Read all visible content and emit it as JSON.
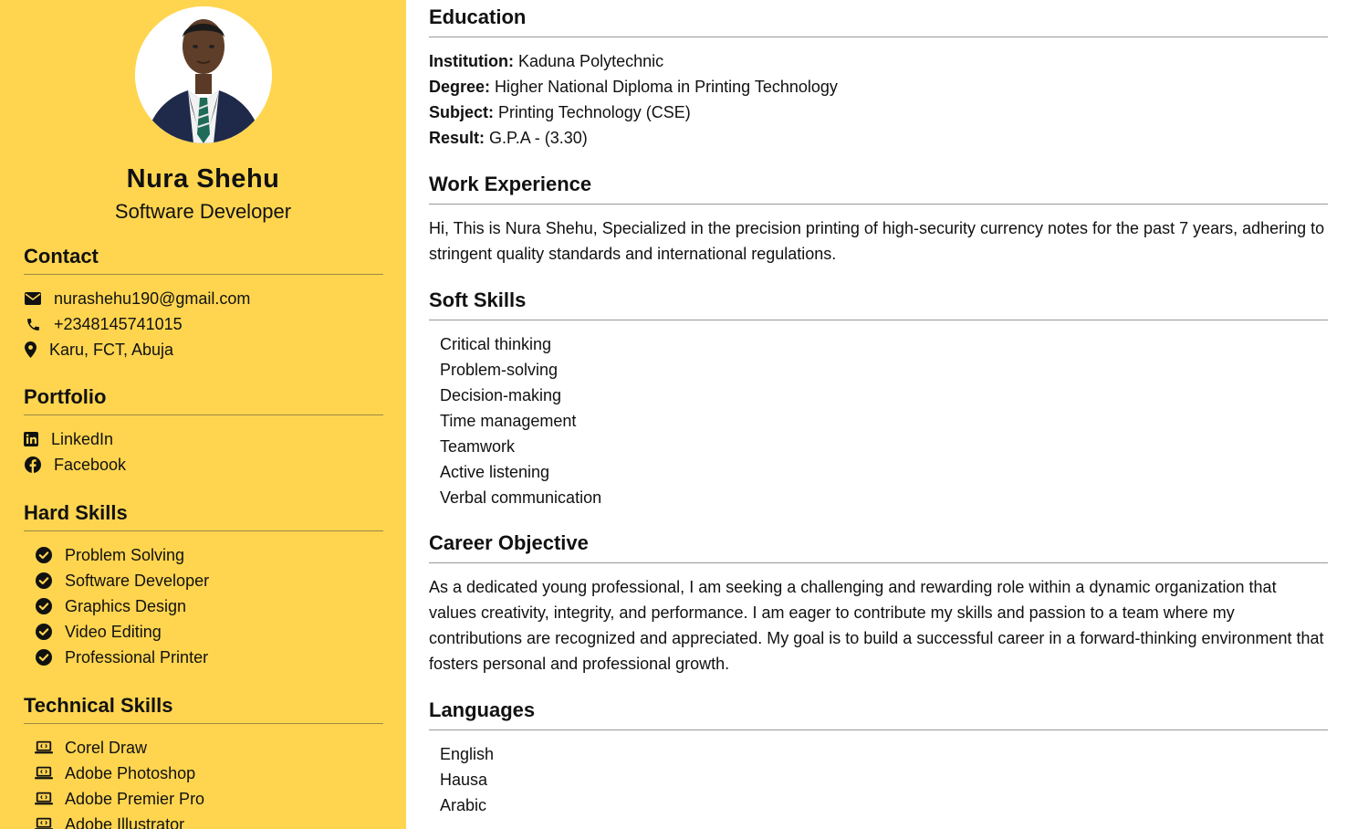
{
  "profile": {
    "name": "Nura Shehu",
    "role": "Software Developer"
  },
  "contact": {
    "title": "Contact",
    "items": [
      {
        "icon": "envelope-icon",
        "text": "nurashehu190@gmail.com"
      },
      {
        "icon": "phone-icon",
        "text": "+2348145741015"
      },
      {
        "icon": "location-pin-icon",
        "text": "Karu, FCT, Abuja"
      }
    ]
  },
  "portfolio": {
    "title": "Portfolio",
    "items": [
      {
        "icon": "linkedin-icon",
        "text": "LinkedIn"
      },
      {
        "icon": "facebook-icon",
        "text": "Facebook"
      }
    ]
  },
  "hard_skills": {
    "title": "Hard Skills",
    "items": [
      "Problem Solving",
      "Software Developer",
      "Graphics Design",
      "Video Editing",
      "Professional Printer"
    ]
  },
  "technical_skills": {
    "title": "Technical Skills",
    "items": [
      "Corel Draw",
      "Adobe Photoshop",
      "Adobe Premier Pro",
      "Adobe Illustrator"
    ]
  },
  "education": {
    "title": "Education",
    "institution_label": "Institution:",
    "institution": "Kaduna Polytechnic",
    "degree_label": "Degree:",
    "degree": "Higher National Diploma in Printing Technology",
    "subject_label": "Subject:",
    "subject": "Printing Technology (CSE)",
    "result_label": "Result:",
    "result": "G.P.A - (3.30)"
  },
  "work_experience": {
    "title": "Work Experience",
    "text": "Hi, This is Nura Shehu, Specialized in the precision printing of high-security currency notes for the past 7 years, adhering to stringent quality standards and international regulations."
  },
  "soft_skills": {
    "title": "Soft Skills",
    "items": [
      "Critical thinking",
      "Problem-solving",
      "Decision-making",
      "Time management",
      "Teamwork",
      "Active listening",
      "Verbal communication"
    ]
  },
  "career_objective": {
    "title": "Career Objective",
    "text": "As a dedicated young professional, I am seeking a challenging and rewarding role within a dynamic organization that values creativity, integrity, and performance. I am eager to contribute my skills and passion to a team where my contributions are recognized and appreciated. My goal is to build a successful career in a forward-thinking environment that fosters personal and professional growth."
  },
  "languages": {
    "title": "Languages",
    "items": [
      "English",
      "Hausa",
      "Arabic"
    ]
  },
  "colors": {
    "sidebar_bg": "#ffd54f",
    "text": "#111111"
  }
}
